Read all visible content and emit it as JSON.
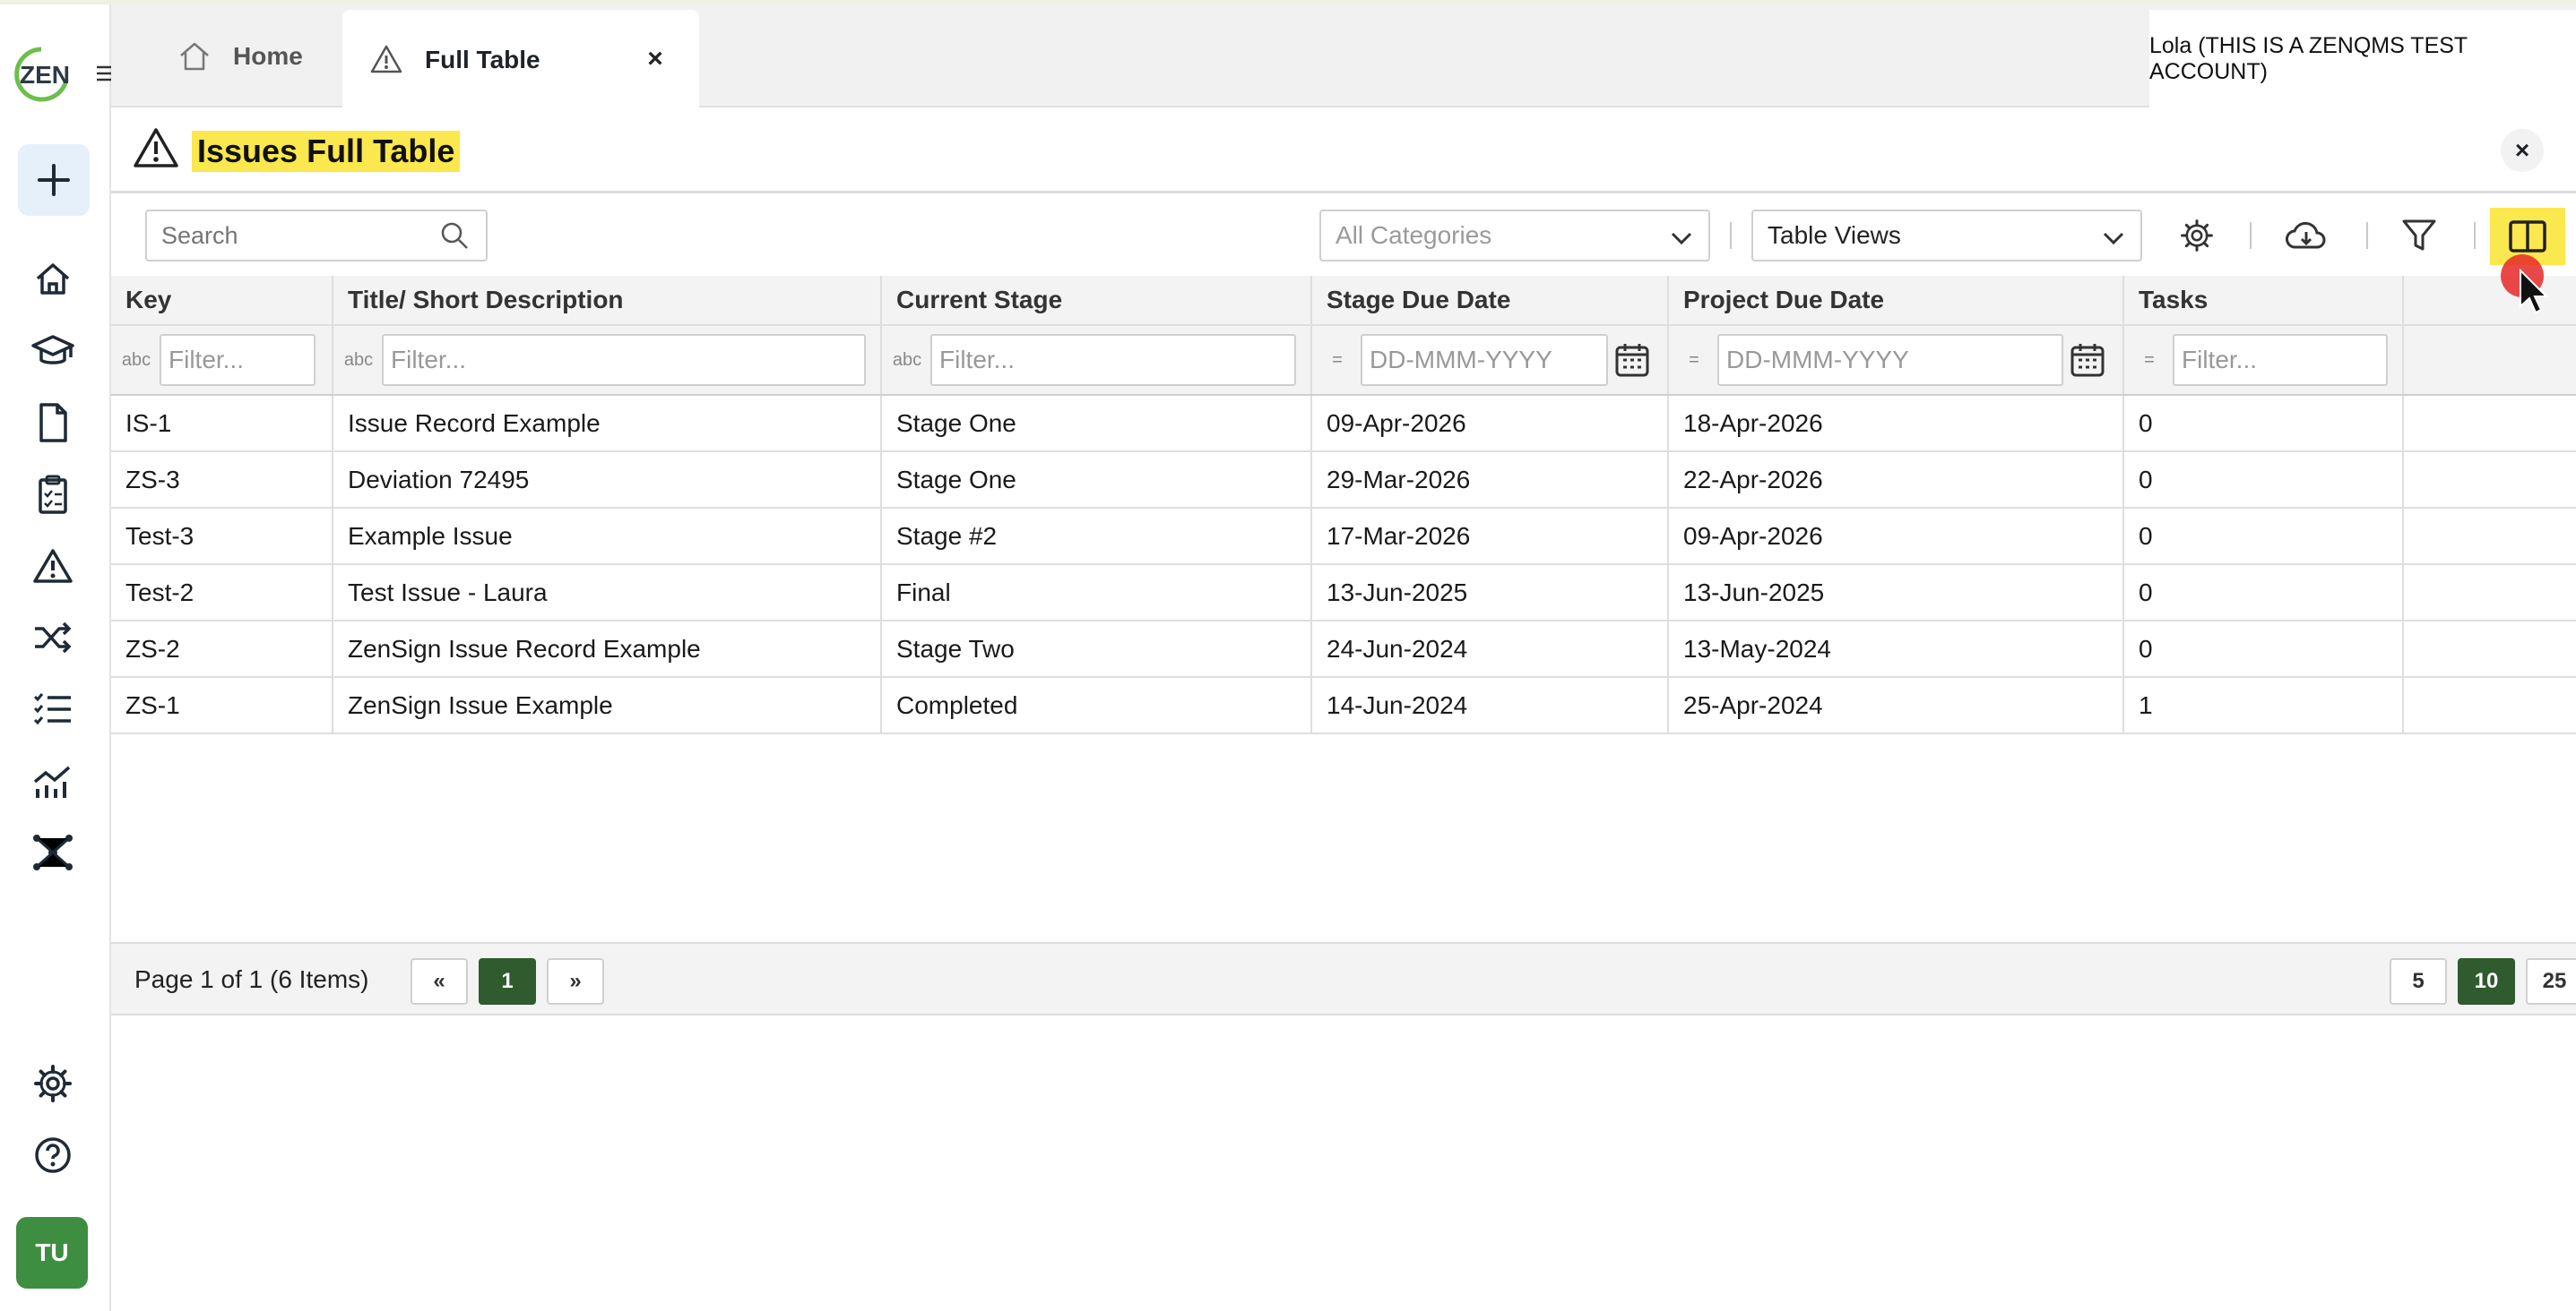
{
  "tabs": {
    "home": "Home",
    "full_table": "Full Table",
    "close": "×",
    "account": "Lola (THIS IS A ZENQMS TEST ACCOUNT)"
  },
  "logo_text": "ZEN",
  "avatar": "TU",
  "page": {
    "title": "Issues Full Table",
    "close": "×"
  },
  "toolbar": {
    "search_placeholder": "Search",
    "categories": "All Categories",
    "views": "Table Views"
  },
  "table": {
    "headers": [
      "Key",
      "Title/ Short Description",
      "Current Stage",
      "Stage Due Date",
      "Project Due Date",
      "Tasks"
    ],
    "filters": {
      "text": "Filter...",
      "date": "DD-MMM-YYYY",
      "text_icon": "abc",
      "eq_icon": "="
    },
    "rows": [
      {
        "key": "IS-1",
        "title": "Issue Record Example",
        "stage": "Stage One",
        "stage_due": "09-Apr-2026",
        "project_due": "18-Apr-2026",
        "tasks": "0"
      },
      {
        "key": "ZS-3",
        "title": "Deviation 72495",
        "stage": "Stage One",
        "stage_due": "29-Mar-2026",
        "project_due": "22-Apr-2026",
        "tasks": "0"
      },
      {
        "key": "Test-3",
        "title": "Example Issue",
        "stage": "Stage #2",
        "stage_due": "17-Mar-2026",
        "project_due": "09-Apr-2026",
        "tasks": "0"
      },
      {
        "key": "Test-2",
        "title": "Test Issue - Laura",
        "stage": "Final",
        "stage_due": "13-Jun-2025",
        "project_due": "13-Jun-2025",
        "tasks": "0"
      },
      {
        "key": "ZS-2",
        "title": "ZenSign Issue Record Example",
        "stage": "Stage Two",
        "stage_due": "24-Jun-2024",
        "project_due": "13-May-2024",
        "tasks": "0"
      },
      {
        "key": "ZS-1",
        "title": "ZenSign Issue Example",
        "stage": "Completed",
        "stage_due": "14-Jun-2024",
        "project_due": "25-Apr-2024",
        "tasks": "1"
      }
    ]
  },
  "pager": {
    "info": "Page 1 of 1 (6 Items)",
    "prev": "«",
    "current": "1",
    "next": "»",
    "sizes": [
      "5",
      "10",
      "25"
    ]
  },
  "colors": {
    "accent_yellow": "#fbe74e",
    "link_blue": "#1f6db0",
    "green": "#2f5b2f"
  }
}
